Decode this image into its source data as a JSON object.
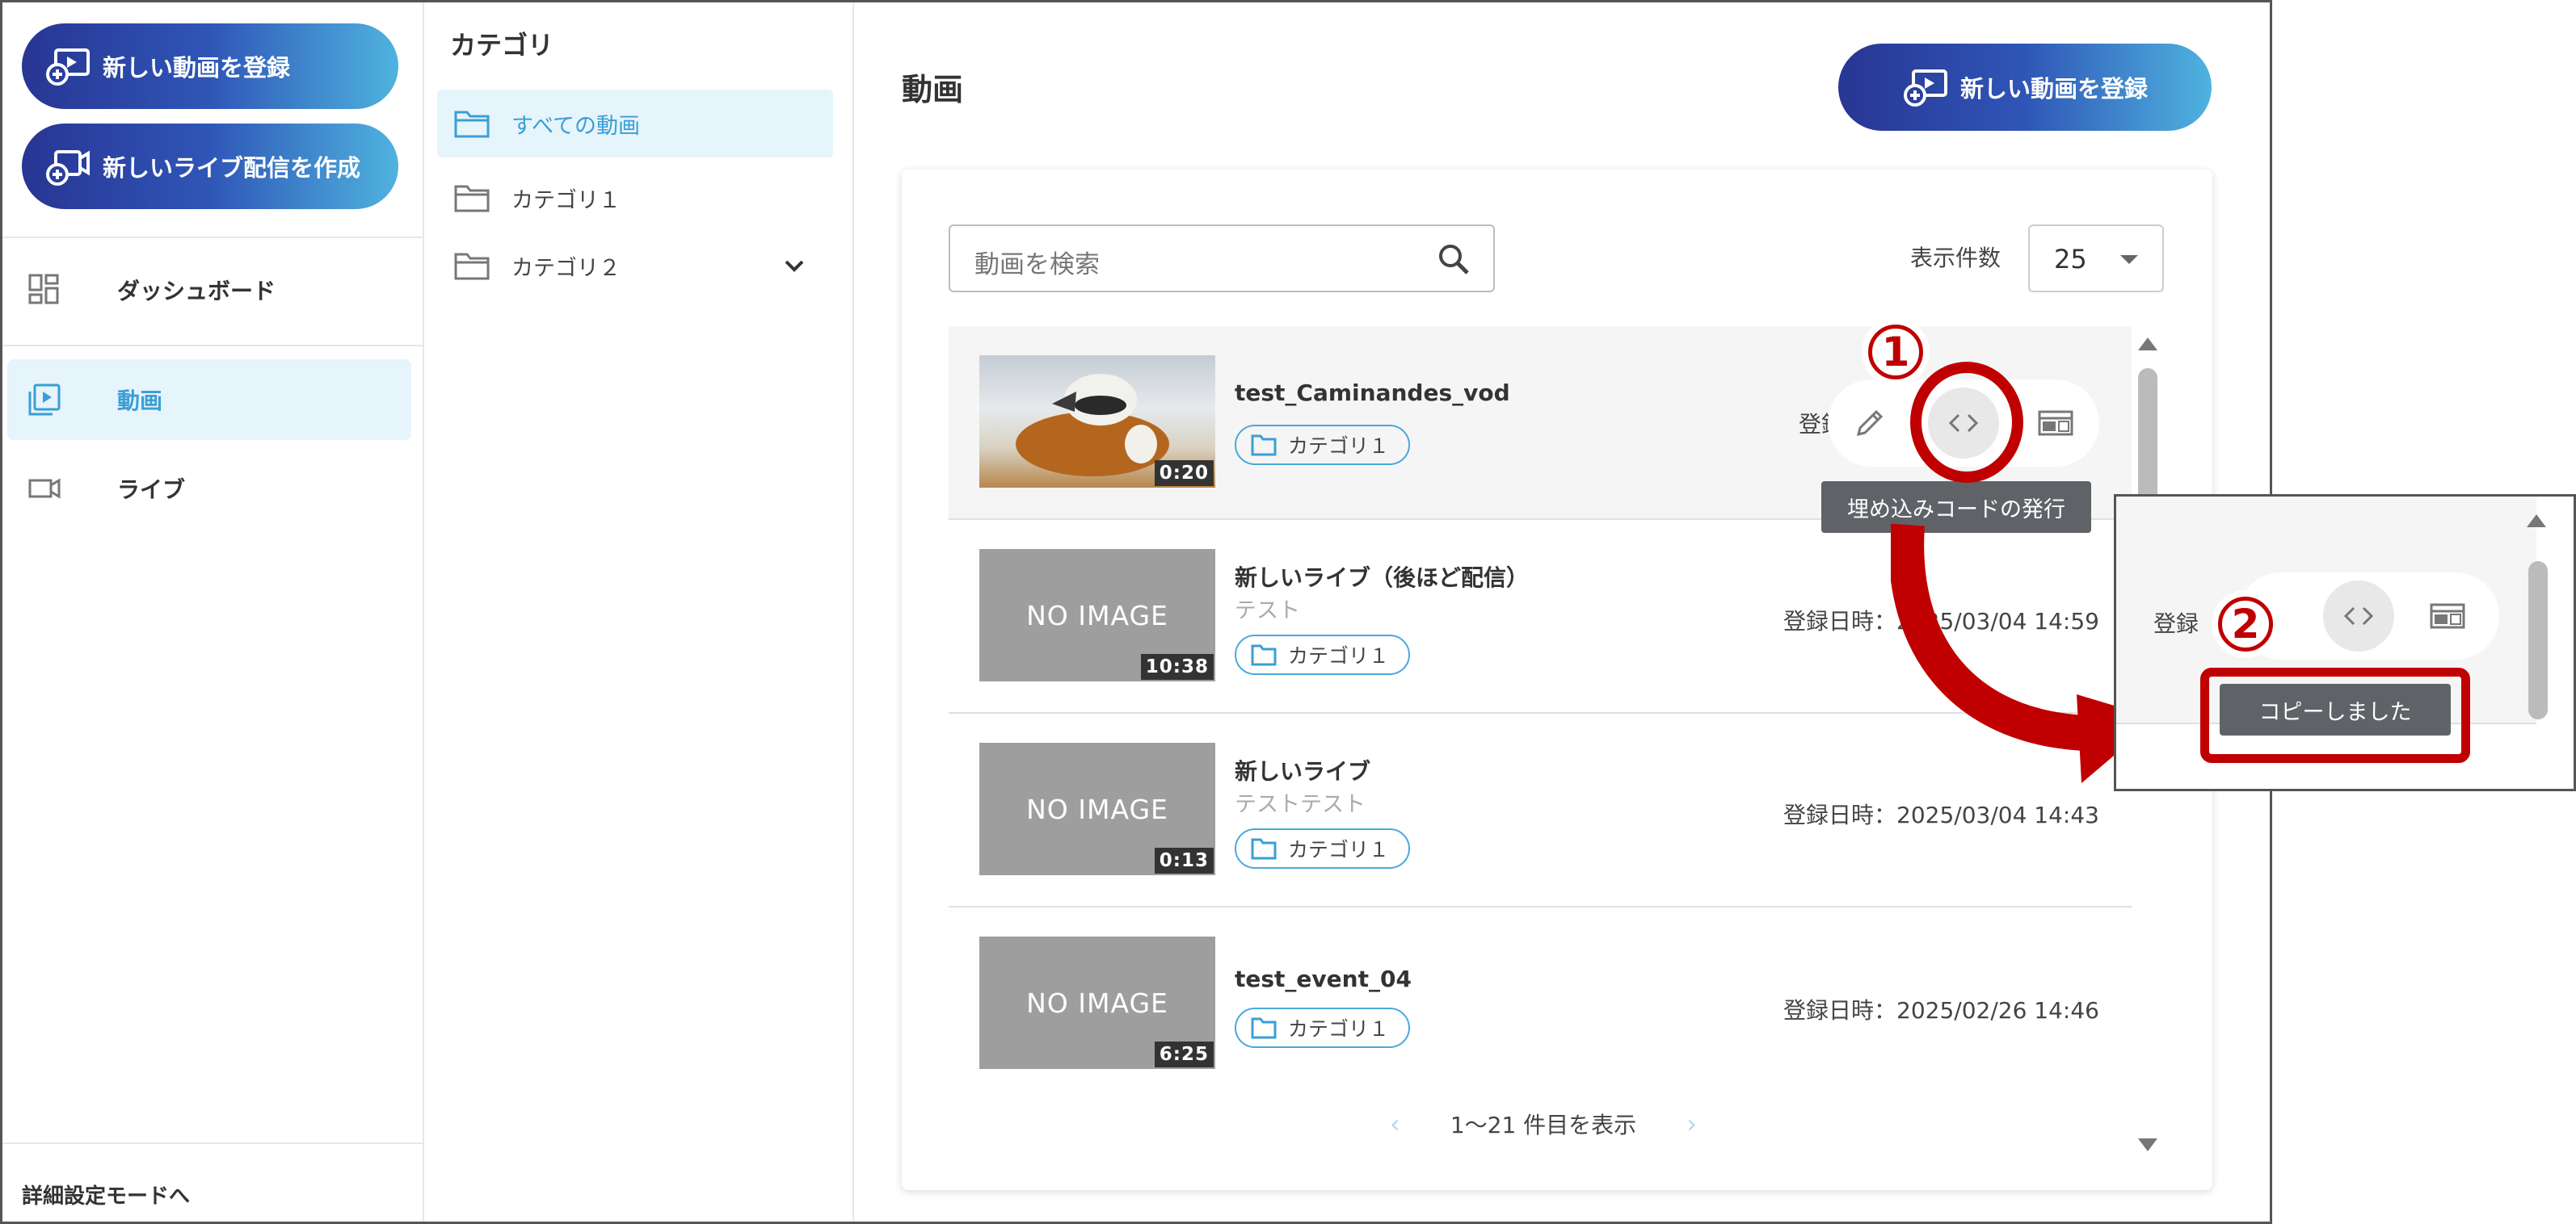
{
  "sidebar": {
    "register_video": "新しい動画を登録",
    "create_live": "新しいライブ配信を作成",
    "nav": [
      {
        "label": "ダッシュボード",
        "icon": "dashboard-icon"
      },
      {
        "label": "動画",
        "icon": "video-library-icon"
      },
      {
        "label": "ライブ",
        "icon": "videocam-icon"
      }
    ],
    "advanced_mode": "詳細設定モードへ"
  },
  "categories": {
    "title": "カテゴリ",
    "items": [
      {
        "label": "すべての動画"
      },
      {
        "label": "カテゴリ１"
      },
      {
        "label": "カテゴリ２"
      }
    ]
  },
  "main": {
    "title": "動画",
    "register_button": "新しい動画を登録",
    "search_placeholder": "動画を検索",
    "per_page_label": "表示件数",
    "per_page_value": "25",
    "pager_text": "1～21 件目を表示"
  },
  "videos": [
    {
      "title": "test_Caminandes_vod",
      "subtitle": "",
      "duration": "0:20",
      "category": "カテゴリ１",
      "date_prefix": "登録",
      "thumb": "photo"
    },
    {
      "title": "新しいライブ（後ほど配信）",
      "subtitle": "テスト",
      "duration": "10:38",
      "category": "カテゴリ１",
      "date": "登録日時：2025/03/04 14:59",
      "thumb": "NO IMAGE"
    },
    {
      "title": "新しいライブ",
      "subtitle": "テストテスト",
      "duration": "0:13",
      "category": "カテゴリ１",
      "date": "登録日時：2025/03/04 14:43",
      "thumb": "NO IMAGE"
    },
    {
      "title": "test_event_04",
      "subtitle": "",
      "duration": "6:25",
      "category": "カテゴリ１",
      "date": "登録日時：2025/02/26 14:46",
      "thumb": "NO IMAGE"
    }
  ],
  "tooltips": {
    "embed": "埋め込みコードの発行",
    "copied": "コピーしました"
  },
  "annotations": {
    "step1": "1",
    "step2": "2",
    "inset_date_prefix": "登録"
  },
  "colors": {
    "accent_red": "#c00000",
    "accent_blue": "#3a9fd5",
    "gradient_start": "#283593",
    "gradient_end": "#4fb3df"
  }
}
